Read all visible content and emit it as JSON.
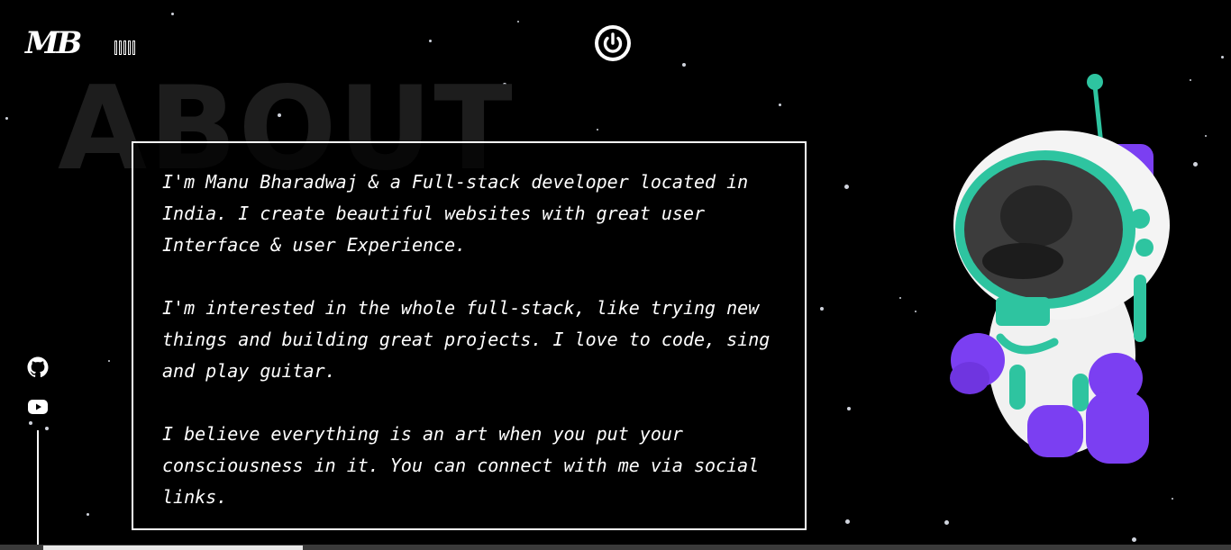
{
  "logo": {
    "text": "MB"
  },
  "header": {
    "sound_icon": "sound-bars-icon",
    "power_icon": "power-icon"
  },
  "page": {
    "background_title": "ABOUT"
  },
  "about": {
    "paragraphs": [
      "I'm Manu Bharadwaj & a Full-stack developer located in India. I create beautiful websites with great user Interface & user Experience.",
      "I'm interested in the whole full-stack, like trying new things and building great projects. I love to code, sing and play guitar.",
      "I believe everything is an art when you put your consciousness in it. You can connect with me via social links."
    ]
  },
  "social": {
    "icons": [
      "github-icon",
      "youtube-icon"
    ]
  },
  "colors": {
    "background": "#000000",
    "text": "#ffffff",
    "bg_title": "#1d1d1d",
    "astronaut_accent": "#2ec4a0",
    "astronaut_purple": "#7b3ff2"
  }
}
